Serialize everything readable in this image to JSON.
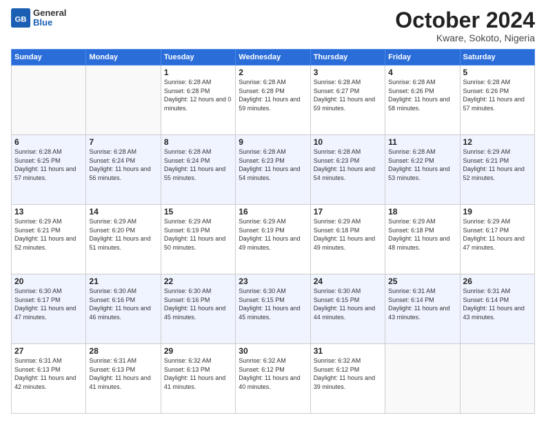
{
  "logo": {
    "general": "General",
    "blue": "Blue"
  },
  "title": "October 2024",
  "subtitle": "Kware, Sokoto, Nigeria",
  "headers": [
    "Sunday",
    "Monday",
    "Tuesday",
    "Wednesday",
    "Thursday",
    "Friday",
    "Saturday"
  ],
  "weeks": [
    [
      {
        "day": "",
        "sunrise": "",
        "sunset": "",
        "daylight": ""
      },
      {
        "day": "",
        "sunrise": "",
        "sunset": "",
        "daylight": ""
      },
      {
        "day": "1",
        "sunrise": "Sunrise: 6:28 AM",
        "sunset": "Sunset: 6:28 PM",
        "daylight": "Daylight: 12 hours and 0 minutes."
      },
      {
        "day": "2",
        "sunrise": "Sunrise: 6:28 AM",
        "sunset": "Sunset: 6:28 PM",
        "daylight": "Daylight: 11 hours and 59 minutes."
      },
      {
        "day": "3",
        "sunrise": "Sunrise: 6:28 AM",
        "sunset": "Sunset: 6:27 PM",
        "daylight": "Daylight: 11 hours and 59 minutes."
      },
      {
        "day": "4",
        "sunrise": "Sunrise: 6:28 AM",
        "sunset": "Sunset: 6:26 PM",
        "daylight": "Daylight: 11 hours and 58 minutes."
      },
      {
        "day": "5",
        "sunrise": "Sunrise: 6:28 AM",
        "sunset": "Sunset: 6:26 PM",
        "daylight": "Daylight: 11 hours and 57 minutes."
      }
    ],
    [
      {
        "day": "6",
        "sunrise": "Sunrise: 6:28 AM",
        "sunset": "Sunset: 6:25 PM",
        "daylight": "Daylight: 11 hours and 57 minutes."
      },
      {
        "day": "7",
        "sunrise": "Sunrise: 6:28 AM",
        "sunset": "Sunset: 6:24 PM",
        "daylight": "Daylight: 11 hours and 56 minutes."
      },
      {
        "day": "8",
        "sunrise": "Sunrise: 6:28 AM",
        "sunset": "Sunset: 6:24 PM",
        "daylight": "Daylight: 11 hours and 55 minutes."
      },
      {
        "day": "9",
        "sunrise": "Sunrise: 6:28 AM",
        "sunset": "Sunset: 6:23 PM",
        "daylight": "Daylight: 11 hours and 54 minutes."
      },
      {
        "day": "10",
        "sunrise": "Sunrise: 6:28 AM",
        "sunset": "Sunset: 6:23 PM",
        "daylight": "Daylight: 11 hours and 54 minutes."
      },
      {
        "day": "11",
        "sunrise": "Sunrise: 6:28 AM",
        "sunset": "Sunset: 6:22 PM",
        "daylight": "Daylight: 11 hours and 53 minutes."
      },
      {
        "day": "12",
        "sunrise": "Sunrise: 6:29 AM",
        "sunset": "Sunset: 6:21 PM",
        "daylight": "Daylight: 11 hours and 52 minutes."
      }
    ],
    [
      {
        "day": "13",
        "sunrise": "Sunrise: 6:29 AM",
        "sunset": "Sunset: 6:21 PM",
        "daylight": "Daylight: 11 hours and 52 minutes."
      },
      {
        "day": "14",
        "sunrise": "Sunrise: 6:29 AM",
        "sunset": "Sunset: 6:20 PM",
        "daylight": "Daylight: 11 hours and 51 minutes."
      },
      {
        "day": "15",
        "sunrise": "Sunrise: 6:29 AM",
        "sunset": "Sunset: 6:19 PM",
        "daylight": "Daylight: 11 hours and 50 minutes."
      },
      {
        "day": "16",
        "sunrise": "Sunrise: 6:29 AM",
        "sunset": "Sunset: 6:19 PM",
        "daylight": "Daylight: 11 hours and 49 minutes."
      },
      {
        "day": "17",
        "sunrise": "Sunrise: 6:29 AM",
        "sunset": "Sunset: 6:18 PM",
        "daylight": "Daylight: 11 hours and 49 minutes."
      },
      {
        "day": "18",
        "sunrise": "Sunrise: 6:29 AM",
        "sunset": "Sunset: 6:18 PM",
        "daylight": "Daylight: 11 hours and 48 minutes."
      },
      {
        "day": "19",
        "sunrise": "Sunrise: 6:29 AM",
        "sunset": "Sunset: 6:17 PM",
        "daylight": "Daylight: 11 hours and 47 minutes."
      }
    ],
    [
      {
        "day": "20",
        "sunrise": "Sunrise: 6:30 AM",
        "sunset": "Sunset: 6:17 PM",
        "daylight": "Daylight: 11 hours and 47 minutes."
      },
      {
        "day": "21",
        "sunrise": "Sunrise: 6:30 AM",
        "sunset": "Sunset: 6:16 PM",
        "daylight": "Daylight: 11 hours and 46 minutes."
      },
      {
        "day": "22",
        "sunrise": "Sunrise: 6:30 AM",
        "sunset": "Sunset: 6:16 PM",
        "daylight": "Daylight: 11 hours and 45 minutes."
      },
      {
        "day": "23",
        "sunrise": "Sunrise: 6:30 AM",
        "sunset": "Sunset: 6:15 PM",
        "daylight": "Daylight: 11 hours and 45 minutes."
      },
      {
        "day": "24",
        "sunrise": "Sunrise: 6:30 AM",
        "sunset": "Sunset: 6:15 PM",
        "daylight": "Daylight: 11 hours and 44 minutes."
      },
      {
        "day": "25",
        "sunrise": "Sunrise: 6:31 AM",
        "sunset": "Sunset: 6:14 PM",
        "daylight": "Daylight: 11 hours and 43 minutes."
      },
      {
        "day": "26",
        "sunrise": "Sunrise: 6:31 AM",
        "sunset": "Sunset: 6:14 PM",
        "daylight": "Daylight: 11 hours and 43 minutes."
      }
    ],
    [
      {
        "day": "27",
        "sunrise": "Sunrise: 6:31 AM",
        "sunset": "Sunset: 6:13 PM",
        "daylight": "Daylight: 11 hours and 42 minutes."
      },
      {
        "day": "28",
        "sunrise": "Sunrise: 6:31 AM",
        "sunset": "Sunset: 6:13 PM",
        "daylight": "Daylight: 11 hours and 41 minutes."
      },
      {
        "day": "29",
        "sunrise": "Sunrise: 6:32 AM",
        "sunset": "Sunset: 6:13 PM",
        "daylight": "Daylight: 11 hours and 41 minutes."
      },
      {
        "day": "30",
        "sunrise": "Sunrise: 6:32 AM",
        "sunset": "Sunset: 6:12 PM",
        "daylight": "Daylight: 11 hours and 40 minutes."
      },
      {
        "day": "31",
        "sunrise": "Sunrise: 6:32 AM",
        "sunset": "Sunset: 6:12 PM",
        "daylight": "Daylight: 11 hours and 39 minutes."
      },
      {
        "day": "",
        "sunrise": "",
        "sunset": "",
        "daylight": ""
      },
      {
        "day": "",
        "sunrise": "",
        "sunset": "",
        "daylight": ""
      }
    ]
  ]
}
